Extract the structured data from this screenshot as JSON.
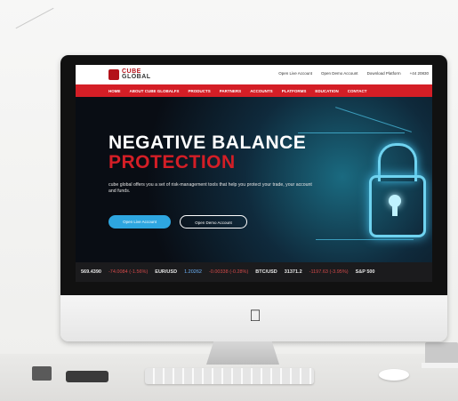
{
  "site": {
    "logo_line1": "CUBE",
    "logo_line2": "GLOBAL",
    "top_links": [
      "Open Live Account",
      "Open Demo Account",
      "Download Platform",
      "+44 20830"
    ],
    "nav": [
      "HOME",
      "ABOUT CUBE GLOBALFX",
      "PRODUCTS",
      "PARTNERS",
      "ACCOUNTS",
      "PLATFORMS",
      "EDUCATION",
      "CONTACT"
    ],
    "hero": {
      "headline_line1": "NEGATIVE BALANCE",
      "headline_line2": "PROTECTION",
      "tagline": "cube global offers you a set of risk-management tools that help you protect your trade, your account and funds.",
      "button_live": "Open Live Account",
      "button_demo": "Open Demo Account"
    },
    "ticker": [
      {
        "text": "569.4390",
        "tone": "white"
      },
      {
        "text": "-74.0084 (-1.56%)",
        "tone": "red"
      },
      {
        "text": "EUR/USD",
        "tone": "white"
      },
      {
        "text": "1.20262",
        "tone": "blue"
      },
      {
        "text": "-0.00338 (-0.28%)",
        "tone": "red"
      },
      {
        "text": "BTC/USD",
        "tone": "white"
      },
      {
        "text": "31371.2",
        "tone": "white"
      },
      {
        "text": "-1197.63 (-3.95%)",
        "tone": "red"
      },
      {
        "text": "S&P 500",
        "tone": "white"
      }
    ]
  },
  "colors": {
    "brand_red": "#d41e26",
    "accent_blue": "#2ea6e0",
    "ticker_bg": "#1b1b1d"
  },
  "icons": {
    "apple_logo": "apple-icon"
  }
}
